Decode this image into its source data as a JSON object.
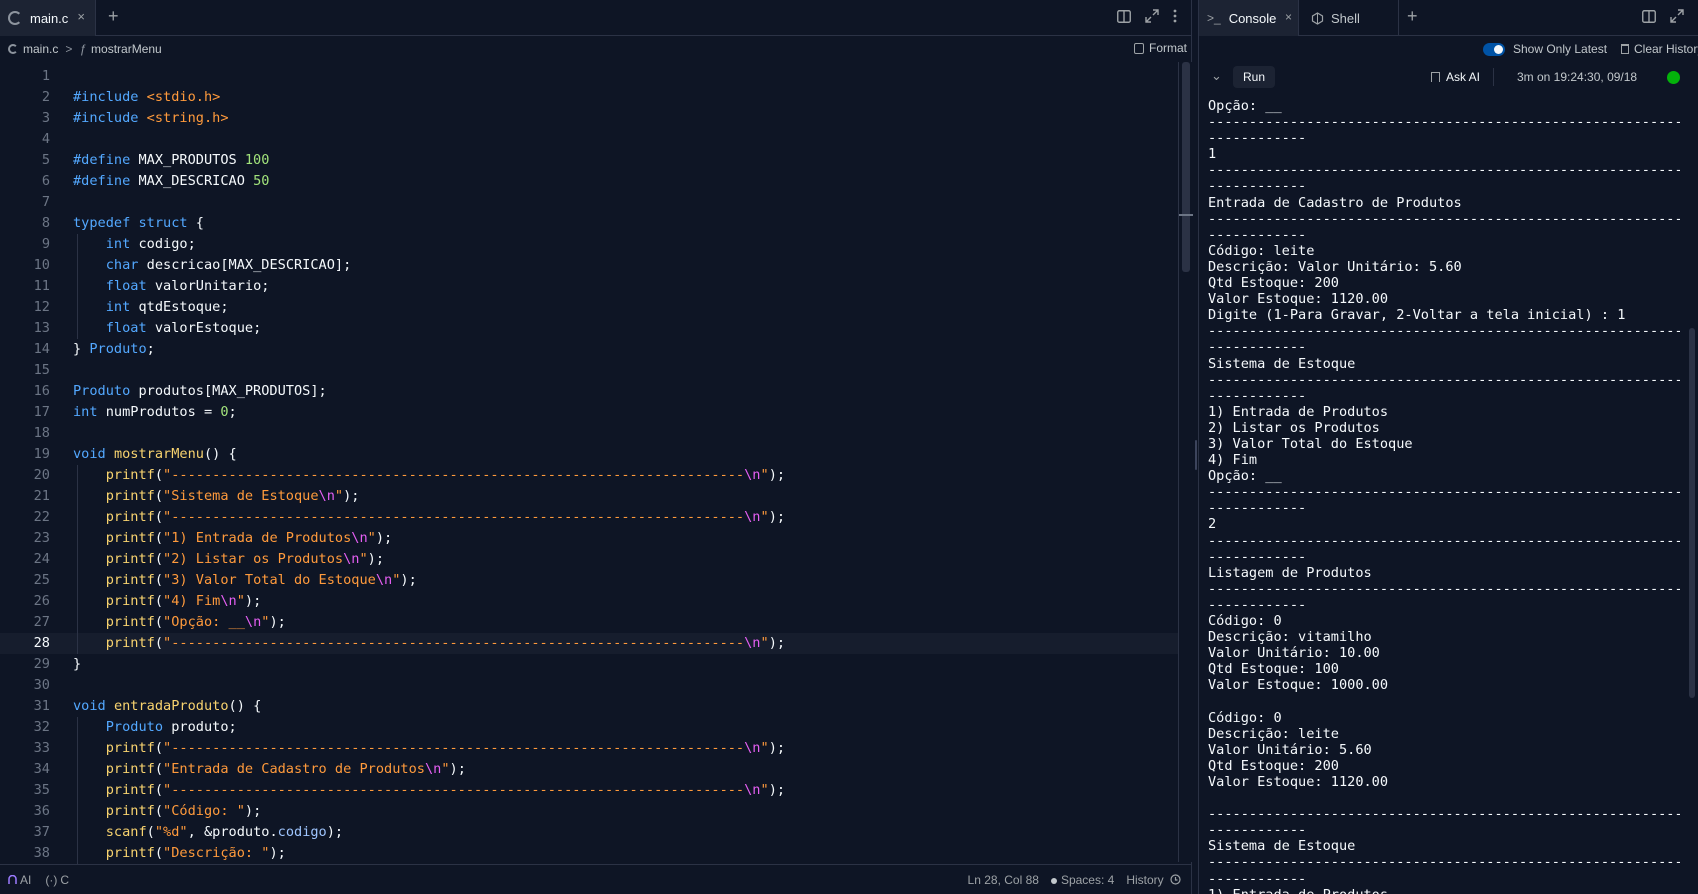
{
  "editor": {
    "tab_label": "main.c",
    "tab_close": "×",
    "new_tab": "+",
    "breadcrumb_file": "main.c",
    "breadcrumb_sep": ">",
    "breadcrumb_fn_glyph": "ƒ",
    "breadcrumb_function": "mostrarMenu",
    "format_label": "Format",
    "current_line": 28,
    "lines": [
      "",
      "#include <stdio.h>",
      "#include <string.h>",
      "",
      "#define MAX_PRODUTOS 100",
      "#define MAX_DESCRICAO 50",
      "",
      "typedef struct {",
      "    int codigo;",
      "    char descricao[MAX_DESCRICAO];",
      "    float valorUnitario;",
      "    int qtdEstoque;",
      "    float valorEstoque;",
      "} Produto;",
      "",
      "Produto produtos[MAX_PRODUTOS];",
      "int numProdutos = 0;",
      "",
      "void mostrarMenu() {",
      "    printf(\"----------------------------------------------------------------------\\n\");",
      "    printf(\"Sistema de Estoque\\n\");",
      "    printf(\"----------------------------------------------------------------------\\n\");",
      "    printf(\"1) Entrada de Produtos\\n\");",
      "    printf(\"2) Listar os Produtos\\n\");",
      "    printf(\"3) Valor Total do Estoque\\n\");",
      "    printf(\"4) Fim\\n\");",
      "    printf(\"Opção: __\\n\");",
      "    printf(\"----------------------------------------------------------------------\\n\");",
      "}",
      "",
      "void entradaProduto() {",
      "    Produto produto;",
      "    printf(\"----------------------------------------------------------------------\\n\");",
      "    printf(\"Entrada de Cadastro de Produtos\\n\");",
      "    printf(\"----------------------------------------------------------------------\\n\");",
      "    printf(\"Código: \");",
      "    scanf(\"%d\", &produto.codigo);",
      "    printf(\"Descrição: \");"
    ]
  },
  "statusbar": {
    "ai_label": "AI",
    "lang_label": "C",
    "cursor": "Ln 28, Col 88",
    "spaces": "Spaces: 4",
    "history": "History"
  },
  "console": {
    "tab_console": "Console",
    "tab_shell": "Shell",
    "tab_close": "×",
    "new_tab": "+",
    "show_only_latest": "Show Only Latest",
    "clear_history": "Clear History",
    "run_label": "Run",
    "ask_ai": "Ask AI",
    "run_info": "3m on 19:24:30, 09/18",
    "status_color": "#04b20b",
    "output": "Opção: __\n--------------------------------------------------------------\n------------\n1\n--------------------------------------------------------------\n------------\nEntrada de Cadastro de Produtos\n--------------------------------------------------------------\n------------\nCódigo: leite\nDescrição: Valor Unitário: 5.60\nQtd Estoque: 200\nValor Estoque: 1120.00\nDigite (1-Para Gravar, 2-Voltar a tela inicial) : 1\n--------------------------------------------------------------\n------------\nSistema de Estoque\n--------------------------------------------------------------\n------------\n1) Entrada de Produtos\n2) Listar os Produtos\n3) Valor Total do Estoque\n4) Fim\nOpção: __\n--------------------------------------------------------------\n------------\n2\n--------------------------------------------------------------\n------------\nListagem de Produtos\n--------------------------------------------------------------\n------------\nCódigo: 0\nDescrição: vitamilho\nValor Unitário: 10.00\nQtd Estoque: 100\nValor Estoque: 1000.00\n\nCódigo: 0\nDescrição: leite\nValor Unitário: 5.60\nQtd Estoque: 200\nValor Estoque: 1120.00\n\n--------------------------------------------------------------\n------------\nSistema de Estoque\n--------------------------------------------------------------\n------------\n1) Entrada de Produtos"
  }
}
